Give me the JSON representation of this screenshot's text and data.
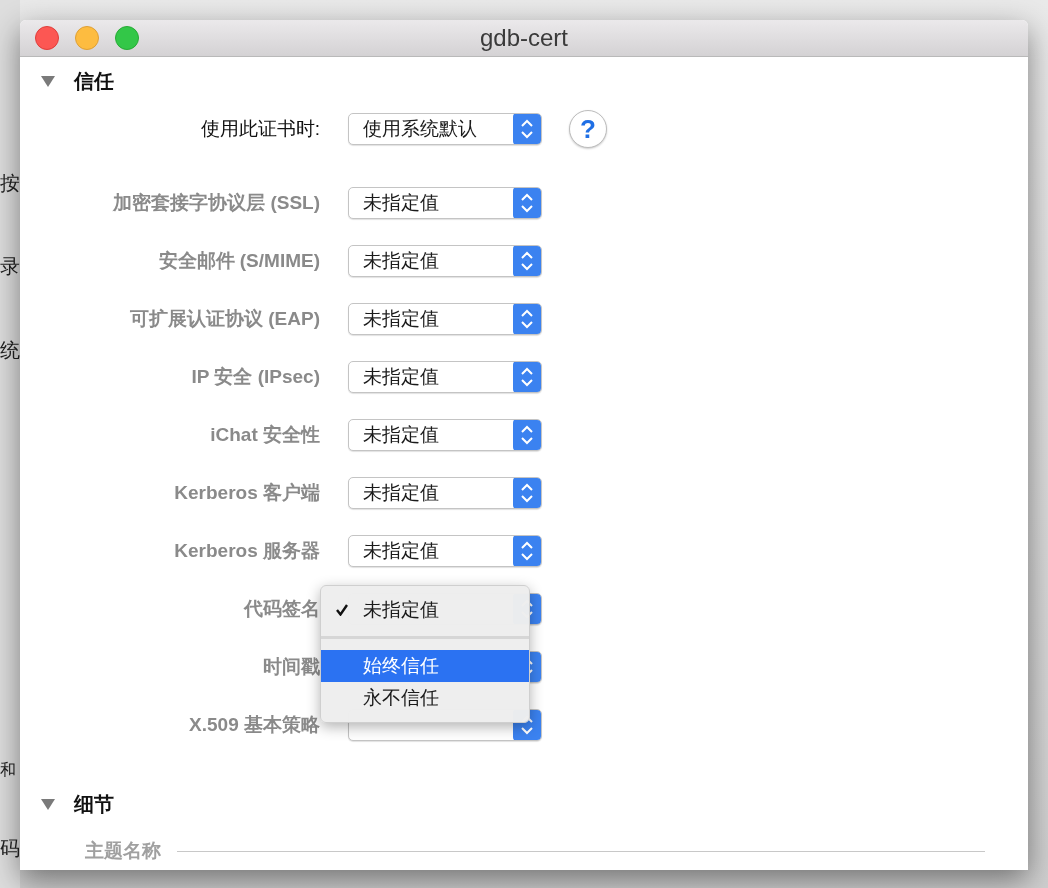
{
  "background_window": {
    "fragments": [
      "按",
      "录",
      "统",
      "和",
      "码"
    ]
  },
  "window": {
    "title": "gdb-cert"
  },
  "trust": {
    "title": "信任",
    "expanded": true,
    "main": {
      "label": "使用此证书时:",
      "value": "使用系统默认",
      "help": "?"
    },
    "rows": [
      {
        "label": "加密套接字协议层 (SSL)",
        "value": "未指定值",
        "open": false
      },
      {
        "label": "安全邮件 (S/MIME)",
        "value": "未指定值",
        "open": false
      },
      {
        "label": "可扩展认证协议 (EAP)",
        "value": "未指定值",
        "open": false
      },
      {
        "label": "IP 安全 (IPsec)",
        "value": "未指定值",
        "open": false
      },
      {
        "label": "iChat 安全性",
        "value": "未指定值",
        "open": false
      },
      {
        "label": "Kerberos 客户端",
        "value": "未指定值",
        "open": false
      },
      {
        "label": "Kerberos 服务器",
        "value": "未指定值",
        "open": false
      },
      {
        "label": "代码签名",
        "open": true
      },
      {
        "label": "时间戳",
        "open": false
      },
      {
        "label": "X.509 基本策略",
        "open": false
      }
    ],
    "menu": [
      {
        "kind": "item",
        "label": "未指定值",
        "checked": true,
        "selected": false
      },
      {
        "kind": "separator"
      },
      {
        "kind": "item",
        "label": "始终信任",
        "checked": false,
        "selected": true
      },
      {
        "kind": "item",
        "label": "永不信任",
        "checked": false,
        "selected": false
      }
    ]
  },
  "details": {
    "title": "细节",
    "expanded": true,
    "field": "主题名称"
  }
}
